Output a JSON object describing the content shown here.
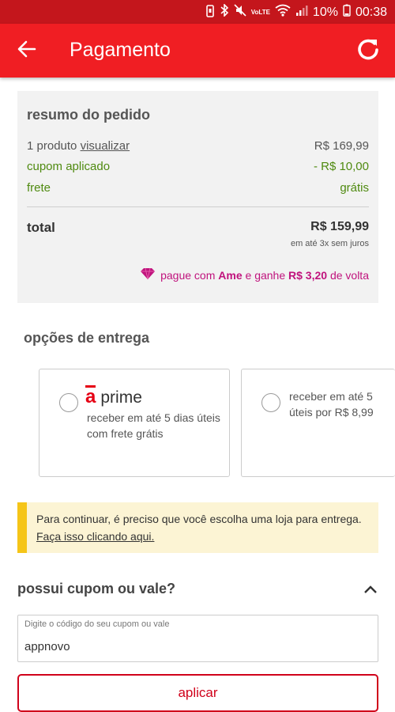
{
  "status_bar": {
    "battery_percent": "10%",
    "time": "00:38",
    "volte": "VoLTE",
    "icons": [
      "vibrate-icon",
      "bluetooth-icon",
      "mute-icon",
      "volte-icon",
      "wifi-icon",
      "signal-icon",
      "battery-icon"
    ]
  },
  "app_bar": {
    "title": "Pagamento",
    "back_icon": "arrow-left-icon",
    "refresh_icon": "refresh-icon"
  },
  "summary": {
    "heading": "resumo do pedido",
    "products_label": "1 produto",
    "view_link": "visualizar",
    "products_value": "R$ 169,99",
    "coupon_label": "cupom aplicado",
    "coupon_value": "- R$ 10,00",
    "shipping_label": "frete",
    "shipping_value": "grátis",
    "total_label": "total",
    "total_value": "R$ 159,99",
    "installments": "em até 3x sem juros",
    "ame_prefix": "pague com",
    "ame_brand": "Ame",
    "ame_middle": "e ganhe",
    "ame_cashback": "R$ 3,20",
    "ame_suffix": "de volta",
    "ame_color": "#c0137d",
    "green_color": "#4f8a10"
  },
  "delivery": {
    "heading": "opções de entrega",
    "options": [
      {
        "logo_letter": "a",
        "logo_word": "prime",
        "text": "receber em até 5 dias úteis com frete grátis",
        "selected": false
      },
      {
        "text_line1": "receber em até 5",
        "text_line2": "úteis por R$ 8,99",
        "selected": false
      }
    ]
  },
  "notice": {
    "text": "Para continuar, é preciso que você escolha uma loja para entrega.",
    "link": "Faça isso clicando aqui.",
    "accent": "#f5c518"
  },
  "coupon": {
    "heading": "possui cupom ou vale?",
    "expanded": true,
    "placeholder": "Digite o código do seu cupom ou vale",
    "value": "appnovo",
    "apply_label": "aplicar"
  },
  "colors": {
    "app_bar": "#f01e23",
    "status_bar": "#c4161c",
    "brand_red": "#d0021b"
  }
}
